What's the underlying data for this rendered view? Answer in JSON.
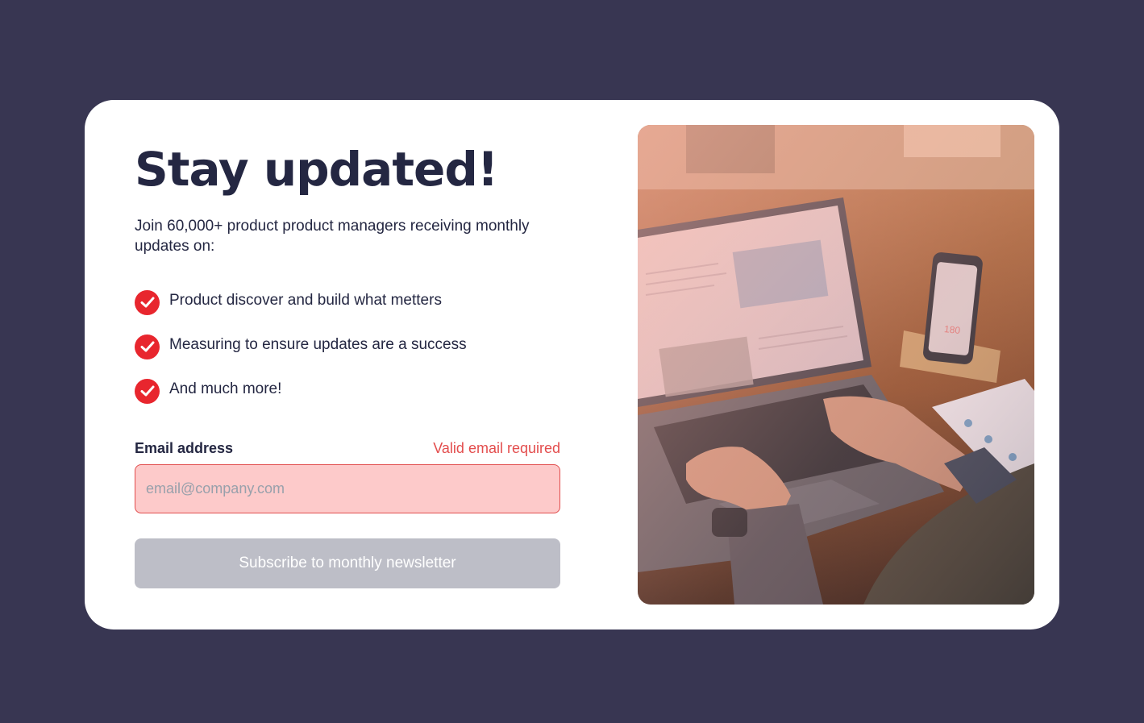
{
  "signup": {
    "title": "Stay updated!",
    "intro": "Join 60,000+ product product managers receiving monthly updates on:",
    "benefits": [
      "Product discover and build what metters",
      "Measuring to ensure updates are a success",
      "And much more!"
    ],
    "email": {
      "label": "Email address",
      "error": "Valid email required",
      "placeholder": "email@company.com",
      "value": ""
    },
    "submit_label": "Subscribe to monthly newsletter"
  },
  "photo": {
    "subject": "laptop-desk-photo",
    "phone_screen_number": "180"
  },
  "colors": {
    "background": "#383652",
    "card": "#ffffff",
    "heading": "#242742",
    "accent_red": "#e8262e",
    "error_text": "#e34d4d",
    "input_error_bg": "#fdcaca",
    "button_disabled": "#bdbec7"
  }
}
